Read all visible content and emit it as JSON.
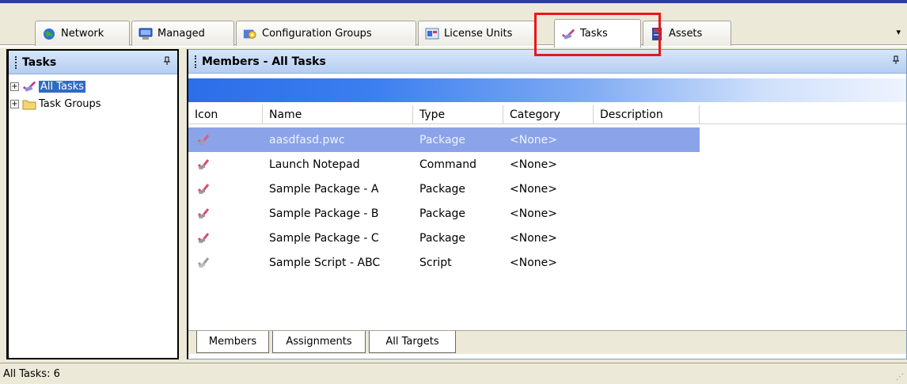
{
  "top_tabs": [
    {
      "label": "Network",
      "icon": "globe-icon"
    },
    {
      "label": "Managed",
      "icon": "computer-icon"
    },
    {
      "label": "Configuration Groups",
      "icon": "config-groups-icon"
    },
    {
      "label": "License Units",
      "icon": "license-units-icon"
    },
    {
      "label": "Tasks",
      "icon": "tasks-icon"
    },
    {
      "label": "Assets",
      "icon": "assets-icon"
    }
  ],
  "tab_overflow": "▾",
  "left_pane": {
    "title": "Tasks",
    "pin": "ᵖ",
    "tree": [
      {
        "expander": "+",
        "label": "All Tasks",
        "icon": "tasks-icon"
      },
      {
        "expander": "+",
        "label": "Task Groups",
        "icon": "folder-icon"
      }
    ]
  },
  "right_pane": {
    "title": "Members - All Tasks",
    "pin": "ᵖ",
    "columns": [
      "Icon",
      "Name",
      "Type",
      "Category",
      "Description"
    ],
    "rows": [
      {
        "name": "aasdfasd.pwc",
        "type": "Package",
        "category": "<None>",
        "description": "",
        "icon": "task-package-icon"
      },
      {
        "name": "Launch Notepad",
        "type": "Command",
        "category": "<None>",
        "description": "",
        "icon": "task-package-icon"
      },
      {
        "name": "Sample Package - A",
        "type": "Package",
        "category": "<None>",
        "description": "",
        "icon": "task-package-icon"
      },
      {
        "name": "Sample Package - B",
        "type": "Package",
        "category": "<None>",
        "description": "",
        "icon": "task-package-icon"
      },
      {
        "name": "Sample Package - C",
        "type": "Package",
        "category": "<None>",
        "description": "",
        "icon": "task-package-icon"
      },
      {
        "name": "Sample Script - ABC",
        "type": "Script",
        "category": "<None>",
        "description": "",
        "icon": "task-script-icon"
      }
    ],
    "bottom_tabs": [
      "Members",
      "Assignments",
      "All Targets"
    ]
  },
  "statusbar": {
    "text": "All Tasks: 6"
  },
  "colors": {
    "highlight": "#e8171a",
    "selection": "#8ba3e8",
    "accent": "#316ac5"
  }
}
